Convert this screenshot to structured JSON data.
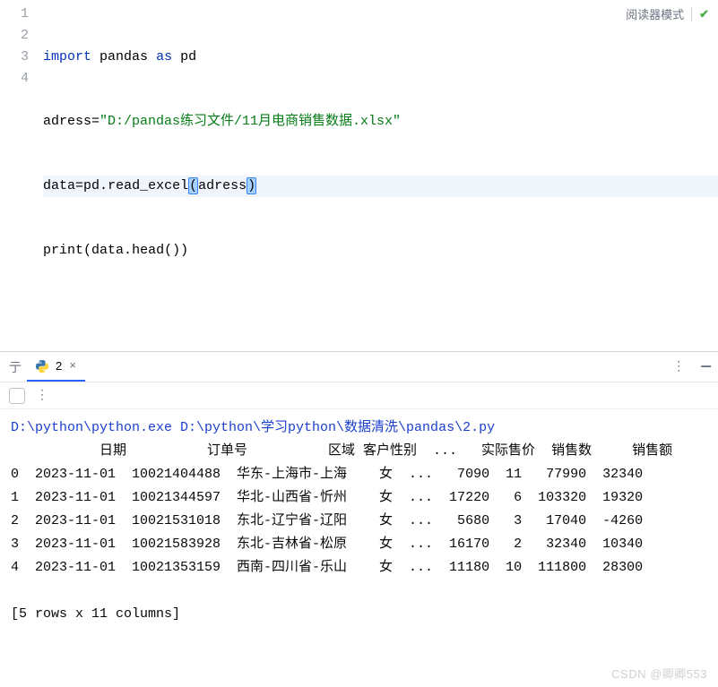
{
  "editor": {
    "reader_mode_label": "阅读器模式",
    "line_numbers": [
      "1",
      "2",
      "3",
      "4"
    ],
    "code": {
      "l1_kw1": "import",
      "l1_mod": "pandas",
      "l1_kw2": "as",
      "l1_alias": "pd",
      "l2_var": "adress",
      "l2_eq": "=",
      "l2_str": "\"D:/pandas练习文件/11月电商销售数据.xlsx\"",
      "l3_var": "data",
      "l3_eq": "=",
      "l3_call_pd": "pd",
      "l3_call_dot": ".",
      "l3_call_fn": "read_excel",
      "l3_open": "(",
      "l3_arg": "adress",
      "l3_close": ")",
      "l4_print": "print",
      "l4_open": "(",
      "l4_data": "data",
      "l4_dot": ".",
      "l4_head": "head",
      "l4_par": "()",
      "l4_close": ")"
    }
  },
  "tabs": {
    "run_glyph": "亍",
    "filename": "2",
    "close_glyph": "×"
  },
  "output": {
    "cmd": "D:\\python\\python.exe D:\\python\\学习python\\数据清洗\\pandas\\2.py",
    "header": "           日期          订单号          区域 客户性别  ...   实际售价  销售数     销售额",
    "rows": [
      "0  2023-11-01  10021404488  华东-上海市-上海    女  ...   7090  11   77990  32340",
      "1  2023-11-01  10021344597  华北-山西省-忻州    女  ...  17220   6  103320  19320",
      "2  2023-11-01  10021531018  东北-辽宁省-辽阳    女  ...   5680   3   17040  -4260",
      "3  2023-11-01  10021583928  东北-吉林省-松原    女  ...  16170   2   32340  10340",
      "4  2023-11-01  10021353159  西南-四川省-乐山    女  ...  11180  10  111800  28300"
    ],
    "footer": "[5 rows x 11 columns]"
  },
  "watermark": "CSDN @卿卿553"
}
